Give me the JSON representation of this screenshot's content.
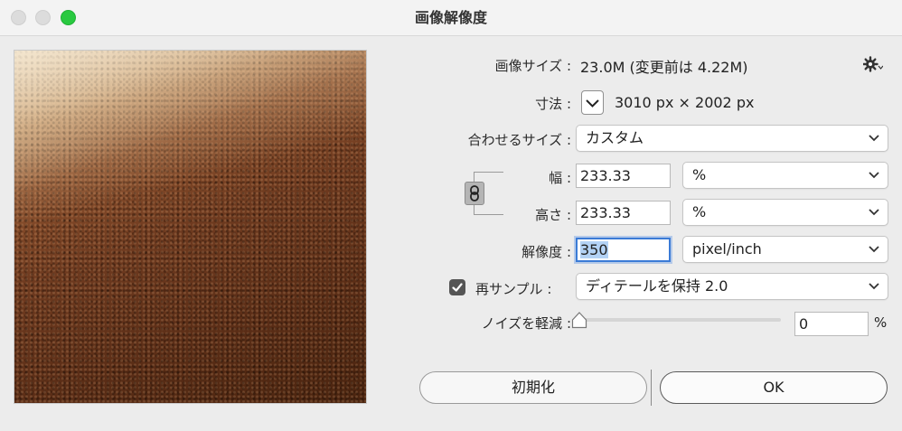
{
  "window": {
    "title": "画像解像度"
  },
  "info": {
    "image_size_label": "画像サイズ :",
    "image_size_value": "23.0M (変更前は 4.22M)",
    "dimensions_label": "寸法 :",
    "dimensions_value": "3010 px × 2002 px"
  },
  "fit_to": {
    "label": "合わせるサイズ :",
    "value": "カスタム"
  },
  "width": {
    "label": "幅 :",
    "value": "233.33",
    "unit": "%"
  },
  "height": {
    "label": "高さ :",
    "value": "233.33",
    "unit": "%"
  },
  "resolution": {
    "label": "解像度 :",
    "value": "350",
    "unit": "pixel/inch"
  },
  "resample": {
    "checked": true,
    "label": "再サンプル :",
    "method": "ディテールを保持 2.0"
  },
  "noise": {
    "label": "ノイズを軽減 :",
    "value": "0",
    "unit": "%",
    "level": 0
  },
  "buttons": {
    "reset": "初期化",
    "ok": "OK"
  },
  "icons": {
    "settings": "gear-icon",
    "dimensions_toggle": "chevron-down-icon",
    "constrain": "link-icon",
    "checkbox": "checkmark-icon",
    "slider": "slider-thumb"
  },
  "colors": {
    "accent_focus": "#3b7bd6",
    "zoom_green": "#29c940"
  }
}
